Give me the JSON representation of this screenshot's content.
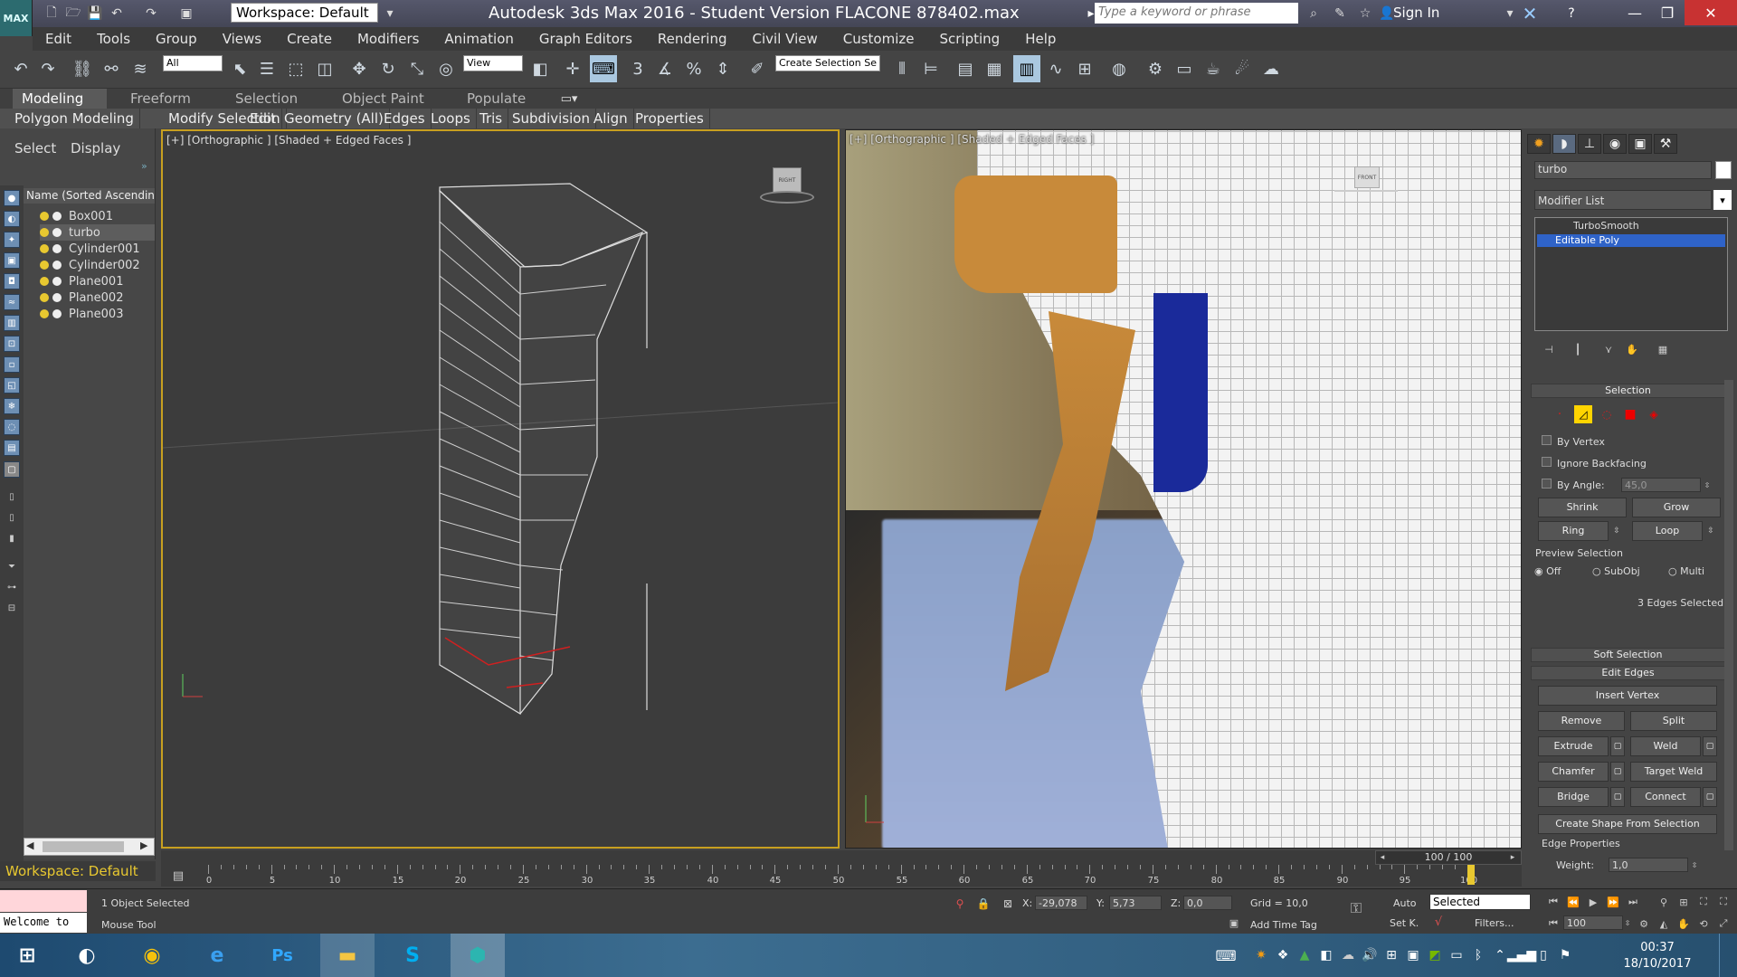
{
  "window": {
    "title": "Autodesk 3ds Max 2016 - Student Version    FLACONE 878402.max",
    "workspace": "Workspace: Default",
    "search_placeholder": "Type a keyword or phrase",
    "sign_in": "Sign In",
    "logo": "MAX"
  },
  "menu": [
    "Edit",
    "Tools",
    "Group",
    "Views",
    "Create",
    "Modifiers",
    "Animation",
    "Graph Editors",
    "Rendering",
    "Civil View",
    "Customize",
    "Scripting",
    "Help"
  ],
  "toolbar": {
    "filter": "All",
    "ref_coord": "View",
    "selection_set": "Create Selection Se"
  },
  "ribbon": {
    "tabs": [
      "Modeling",
      "Freeform",
      "Selection",
      "Object Paint",
      "Populate"
    ],
    "active_tab": "Modeling",
    "sub": [
      "Polygon Modeling",
      "Modify Selection",
      "Edit",
      "Geometry (All)",
      "Edges",
      "Loops",
      "Tris",
      "Subdivision",
      "Align",
      "Properties"
    ]
  },
  "scene_explorer": {
    "tabs": [
      "Select",
      "Display"
    ],
    "header": "Name (Sorted Ascending)",
    "objects": [
      "Box001",
      "turbo",
      "Cylinder001",
      "Cylinder002",
      "Plane001",
      "Plane002",
      "Plane003"
    ],
    "selected": "turbo",
    "workspace_label": "Workspace: Default"
  },
  "viewports": {
    "left_label": "[+] [Orthographic ] [Shaded + Edged Faces ]",
    "right_label": "[+] [Orthographic ] [Shaded + Edged Faces ]",
    "left_cube": "RIGHT",
    "right_cube": "FRONT"
  },
  "command_panel": {
    "object_name": "turbo",
    "modifier_list": "Modifier List",
    "stack": [
      "TurboSmooth",
      "Editable Poly"
    ],
    "selected_modifier": "Editable Poly",
    "selection_title": "Selection",
    "by_vertex": "By Vertex",
    "ignore_backfacing": "Ignore Backfacing",
    "by_angle": "By Angle:",
    "angle_value": "45,0",
    "shrink": "Shrink",
    "grow": "Grow",
    "ring": "Ring",
    "loop": "Loop",
    "preview_selection": "Preview Selection",
    "preview_opts": [
      "Off",
      "SubObj",
      "Multi"
    ],
    "edges_selected": "3 Edges Selected",
    "soft_selection": "Soft Selection",
    "edit_edges": "Edit Edges",
    "insert_vertex": "Insert Vertex",
    "remove": "Remove",
    "split": "Split",
    "extrude": "Extrude",
    "weld": "Weld",
    "chamfer": "Chamfer",
    "target_weld": "Target Weld",
    "bridge": "Bridge",
    "connect": "Connect",
    "create_shape": "Create Shape From Selection",
    "edge_properties": "Edge Properties",
    "weight_label": "Weight:",
    "weight_value": "1,0"
  },
  "timeline": {
    "frame": "100 / 100",
    "ticks": [
      "0",
      "5",
      "10",
      "15",
      "20",
      "25",
      "30",
      "35",
      "40",
      "45",
      "50",
      "55",
      "60",
      "65",
      "70",
      "75",
      "80",
      "85",
      "90",
      "95",
      "100"
    ]
  },
  "status": {
    "selected": "1 Object Selected",
    "mouse_tool": "Mouse Tool",
    "welcome": "Welcome to",
    "x_label": "X:",
    "x": "-29,078",
    "y_label": "Y:",
    "y": "5,73",
    "z_label": "Z:",
    "z": "0,0",
    "grid": "Grid = 10,0",
    "add_time_tag": "Add Time Tag",
    "auto": "Auto",
    "set_key": "Set K.",
    "key_mode": "Selected",
    "filters": "Filters...",
    "frame_field": "100"
  },
  "taskbar": {
    "apps": [
      "Windows",
      "Steam",
      "Chrome",
      "Internet Explorer",
      "Photoshop",
      "File Explorer",
      "Skype",
      "3ds Max"
    ],
    "time": "00:37",
    "date": "18/10/2017"
  }
}
